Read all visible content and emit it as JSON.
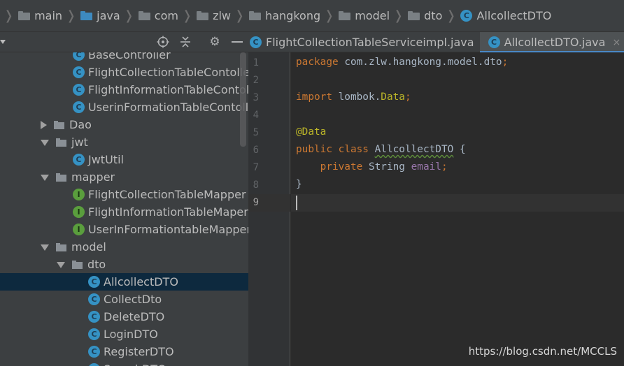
{
  "breadcrumb": [
    {
      "label": "main",
      "icon": "folder-icon"
    },
    {
      "label": "java",
      "icon": "source-folder-icon"
    },
    {
      "label": "com",
      "icon": "package-icon"
    },
    {
      "label": "zlw",
      "icon": "package-icon"
    },
    {
      "label": "hangkong",
      "icon": "package-icon"
    },
    {
      "label": "model",
      "icon": "package-icon"
    },
    {
      "label": "dto",
      "icon": "package-icon"
    },
    {
      "label": "AllcollectDTO",
      "icon": "class-icon"
    }
  ],
  "class_icon_letter": "C",
  "interface_icon_letter": "I",
  "tree": [
    {
      "label": "BaseController",
      "kind": "class",
      "indent": 104
    },
    {
      "label": "FlightCollectionTableContoller",
      "kind": "class",
      "indent": 104
    },
    {
      "label": "FlightInformationTableContoller",
      "kind": "class",
      "indent": 104
    },
    {
      "label": "UserinFormationTableContoller",
      "kind": "class",
      "indent": 104
    },
    {
      "label": "Dao",
      "kind": "folder",
      "expanded": false,
      "indent": 58
    },
    {
      "label": "jwt",
      "kind": "folder",
      "expanded": true,
      "indent": 58
    },
    {
      "label": "JwtUtil",
      "kind": "class",
      "indent": 104
    },
    {
      "label": "mapper",
      "kind": "folder",
      "expanded": true,
      "indent": 58
    },
    {
      "label": "FlightCollectionTableMapper",
      "kind": "interface",
      "indent": 104
    },
    {
      "label": "FlightInformationTableMaper",
      "kind": "interface",
      "indent": 104
    },
    {
      "label": "UserInFormationtableMapper",
      "kind": "interface",
      "indent": 104
    },
    {
      "label": "model",
      "kind": "folder",
      "expanded": true,
      "indent": 58
    },
    {
      "label": "dto",
      "kind": "folder",
      "expanded": true,
      "indent": 81
    },
    {
      "label": "AllcollectDTO",
      "kind": "class",
      "indent": 126,
      "selected": true
    },
    {
      "label": "CollectDto",
      "kind": "class",
      "indent": 126
    },
    {
      "label": "DeleteDTO",
      "kind": "class",
      "indent": 126
    },
    {
      "label": "LoginDTO",
      "kind": "class",
      "indent": 126
    },
    {
      "label": "RegisterDTO",
      "kind": "class",
      "indent": 126
    },
    {
      "label": "SearchDTO",
      "kind": "class",
      "indent": 126
    }
  ],
  "tabs": [
    {
      "label": "FlightCollectionTableServiceimpl.java",
      "active": false,
      "closable": false
    },
    {
      "label": "AllcollectDTO.java",
      "active": true,
      "closable": true,
      "close_glyph": "×"
    },
    {
      "label": "",
      "active": false,
      "closable": false
    }
  ],
  "editor": {
    "line_numbers": [
      "1",
      "2",
      "3",
      "4",
      "5",
      "6",
      "7",
      "8",
      "9"
    ],
    "current_line": 9,
    "lines": [
      [
        {
          "t": "package",
          "c": "kw"
        },
        {
          "t": " com.zlw.hangkong.model.dto",
          "c": ""
        },
        {
          "t": ";",
          "c": "kw"
        }
      ],
      [],
      [
        {
          "t": "import",
          "c": "kw"
        },
        {
          "t": " lombok.",
          "c": ""
        },
        {
          "t": "Data",
          "c": "ann"
        },
        {
          "t": ";",
          "c": "kw"
        }
      ],
      [],
      [
        {
          "t": "@Data",
          "c": "ann"
        }
      ],
      [
        {
          "t": "public",
          "c": "kw"
        },
        {
          "t": " ",
          "c": ""
        },
        {
          "t": "class",
          "c": "kw"
        },
        {
          "t": " ",
          "c": ""
        },
        {
          "t": "AllcollectDTO",
          "c": "cls"
        },
        {
          "t": " {",
          "c": ""
        }
      ],
      [
        {
          "t": "    ",
          "c": ""
        },
        {
          "t": "private",
          "c": "kw"
        },
        {
          "t": " String ",
          "c": ""
        },
        {
          "t": "email",
          "c": "fld"
        },
        {
          "t": ";",
          "c": "kw"
        }
      ],
      [
        {
          "t": "}",
          "c": ""
        }
      ],
      []
    ]
  },
  "watermark": "https://blog.csdn.net/MCCLS"
}
